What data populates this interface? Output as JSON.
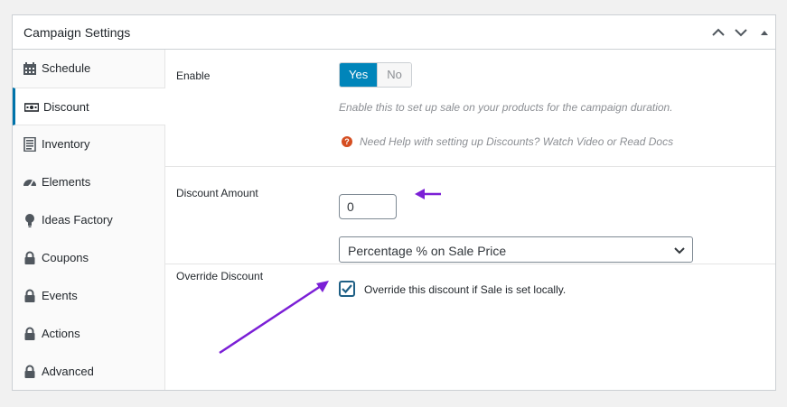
{
  "panel": {
    "title": "Campaign Settings",
    "controls": {
      "up_icon": "chevron-up-icon",
      "down_icon": "chevron-down-icon",
      "toggle_icon": "triangle-up-icon"
    }
  },
  "sidebar": {
    "items": [
      {
        "label": "Schedule",
        "icon": "calendar-icon",
        "active": false
      },
      {
        "label": "Discount",
        "icon": "money-icon",
        "active": true
      },
      {
        "label": "Inventory",
        "icon": "list-document-icon",
        "active": false
      },
      {
        "label": "Elements",
        "icon": "dashboard-gauge-icon",
        "active": false
      },
      {
        "label": "Ideas Factory",
        "icon": "lightbulb-icon",
        "active": false
      },
      {
        "label": "Coupons",
        "icon": "lock-icon",
        "active": false
      },
      {
        "label": "Events",
        "icon": "lock-icon",
        "active": false
      },
      {
        "label": "Actions",
        "icon": "lock-icon",
        "active": false
      },
      {
        "label": "Advanced",
        "icon": "lock-icon",
        "active": false
      }
    ]
  },
  "enable": {
    "label": "Enable",
    "yes_label": "Yes",
    "no_label": "No",
    "selected": "Yes",
    "description": "Enable this to set up sale on your products for the campaign duration.",
    "help_text": "Need Help with setting up Discounts? Watch Video or Read Docs",
    "help_icon_glyph": "?"
  },
  "discount_amount": {
    "label": "Discount Amount",
    "value": "0",
    "type_options_selected": "Percentage % on Sale Price"
  },
  "override": {
    "label": "Override Discount",
    "checked": true,
    "checkbox_label": "Override this discount if Sale is set locally."
  },
  "colors": {
    "accent": "#0085ba",
    "annotation_arrow": "#7b1fd6",
    "help_icon": "#d54e21"
  }
}
